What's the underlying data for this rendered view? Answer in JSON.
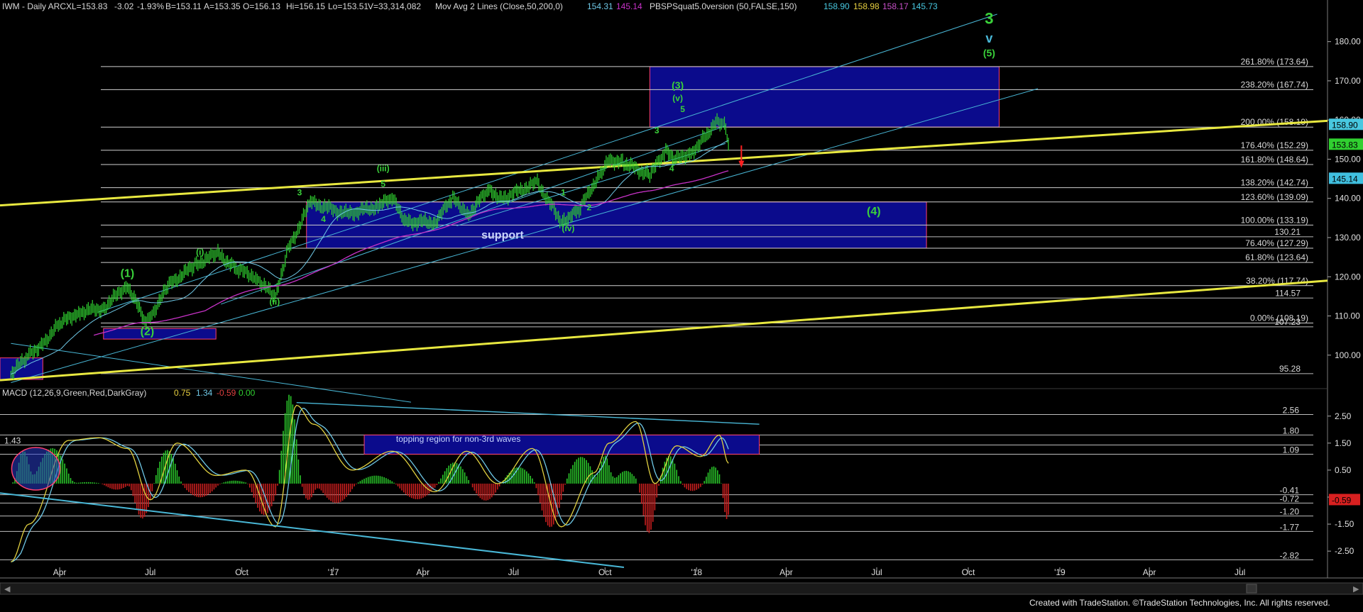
{
  "header": {
    "symbol": "IWM - Daily ARCX",
    "last": "L=153.83",
    "change": "-3.02",
    "pct": "-1.93%",
    "bid": "B=153.11",
    "ask": "A=153.35",
    "open": "O=156.13",
    "high": "Hi=156.15",
    "low": "Lo=153.51",
    "volume": "V=33,314,082",
    "study1": "Mov Avg 2 Lines (Close,50,200,0)",
    "ma50": "154.31",
    "ma200": "145.14",
    "study2": "PBSPSquat5.0version (50,FALSE,150)",
    "sq1": "158.90",
    "sq2": "158.98",
    "sq3": "158.17",
    "sq4": "145.73"
  },
  "macd_header": {
    "title": "MACD (12,26,9,Green,Red,DarkGray)",
    "v1": "0.75",
    "v2": "1.34",
    "v3": "-0.59",
    "v4": "0.00"
  },
  "footer": "Created with TradeStation. ©TradeStation Technologies, Inc. All rights reserved.",
  "colors": {
    "background": "#000000",
    "price": "#30d030",
    "ma50": "#6fc8e6",
    "ma200": "#c832c8",
    "trendline": "#e8e840",
    "channel": "#49b7d6",
    "box_fill": "#0b0b8c",
    "box_edge": "#ff3f6f",
    "fib_line": "#cfcfcf",
    "wave_label": "#3ad13a",
    "macd_hist_pos": "#2ac62a",
    "macd_hist_neg": "#c81e1e",
    "macd_line": "#e0d040",
    "signal_line": "#6fc8e6"
  },
  "chart_data": [
    {
      "type": "line",
      "title": "",
      "series": [
        {
          "name": "IWM",
          "x": [
            "2016-02-12",
            "2016-03-01",
            "2016-03-15",
            "2016-04-01",
            "2016-04-20",
            "2016-05-15",
            "2016-06-08",
            "2016-06-27",
            "2016-07-20",
            "2016-08-15",
            "2016-09-07",
            "2016-09-25",
            "2016-10-15",
            "2016-11-04",
            "2016-11-15",
            "2016-12-09",
            "2017-01-15",
            "2017-02-15",
            "2017-03-01",
            "2017-03-15",
            "2017-04-13",
            "2017-05-01",
            "2017-05-17",
            "2017-06-05",
            "2017-06-20",
            "2017-07-25",
            "2017-08-18",
            "2017-09-05",
            "2017-09-25",
            "2017-10-05",
            "2017-10-20",
            "2017-11-15",
            "2017-12-01",
            "2017-12-12",
            "2017-12-28",
            "2018-01-10",
            "2018-01-23",
            "2018-01-29",
            "2018-02-02"
          ],
          "y": [
            95.3,
            100,
            103,
            108,
            111,
            112,
            118,
            108,
            118,
            123,
            126,
            122,
            120,
            114.6,
            126,
            139,
            136,
            138,
            140,
            134,
            134,
            140,
            136,
            142,
            140,
            144,
            134,
            137,
            146,
            150,
            149,
            146,
            152,
            150,
            152,
            156,
            160,
            158.5,
            153.8
          ]
        }
      ],
      "ma_lines": {
        "ma50": "154.31",
        "ma200": "145.14"
      },
      "fib_levels": [
        {
          "label": "261.80% (173.64)",
          "y": 173.64
        },
        {
          "label": "238.20% (167.74)",
          "y": 167.74
        },
        {
          "label": "200.00% (158.19)",
          "y": 158.19
        },
        {
          "label": "176.40% (152.29)",
          "y": 152.29
        },
        {
          "label": "161.80% (148.64)",
          "y": 148.64
        },
        {
          "label": "138.20% (142.74)",
          "y": 142.74
        },
        {
          "label": "123.60% (139.09)",
          "y": 139.09
        },
        {
          "label": "100.00% (133.19)",
          "y": 133.19
        },
        {
          "label": "76.40% (127.29)",
          "y": 127.29
        },
        {
          "label": "61.80% (123.64)",
          "y": 123.64
        },
        {
          "label": "38.20% (117.74)",
          "y": 117.74
        },
        {
          "label": "0.00% (108.19)",
          "y": 108.19
        }
      ],
      "price_labels": [
        {
          "label": "130.21",
          "y": 130.21
        },
        {
          "label": "114.57",
          "y": 114.57
        },
        {
          "label": "107.23",
          "y": 107.23
        },
        {
          "label": "95.28",
          "y": 95.28
        }
      ],
      "price_tags": [
        {
          "label": "158.90",
          "y": 158.9,
          "color": "#48c8e0"
        },
        {
          "label": "153.83",
          "y": 153.83,
          "color": "#30d030"
        },
        {
          "label": "145.14",
          "y": 145.14,
          "color": "#40c0e0"
        }
      ],
      "yticks": [
        100,
        110,
        120,
        130,
        140,
        150,
        160,
        170,
        180
      ],
      "ylim": [
        92,
        187
      ],
      "xticks": [
        {
          "label": "Apr",
          "x": "2016-04-01"
        },
        {
          "label": "Jul",
          "x": "2016-07-01"
        },
        {
          "label": "Oct",
          "x": "2016-10-01"
        },
        {
          "label": "'17",
          "x": "2017-01-01"
        },
        {
          "label": "Apr",
          "x": "2017-04-01"
        },
        {
          "label": "Jul",
          "x": "2017-07-01"
        },
        {
          "label": "Oct",
          "x": "2017-10-01"
        },
        {
          "label": "'18",
          "x": "2018-01-01"
        },
        {
          "label": "Apr",
          "x": "2018-04-01"
        },
        {
          "label": "Jul",
          "x": "2018-07-01"
        },
        {
          "label": "Oct",
          "x": "2018-10-01"
        },
        {
          "label": "'19",
          "x": "2019-01-01"
        },
        {
          "label": "Apr",
          "x": "2019-04-01"
        },
        {
          "label": "Jul",
          "x": "2019-07-01"
        }
      ],
      "xlim": [
        "2016-02-01",
        "2019-09-27"
      ],
      "boxes": [
        {
          "x0": "2017-11-15",
          "x1": "2018-11-01",
          "y0": 158.2,
          "y1": 173.6,
          "label": ""
        },
        {
          "x0": "2016-12-05",
          "x1": "2018-08-20",
          "y0": 127.3,
          "y1": 139.1,
          "label": "support"
        },
        {
          "x0": "2016-05-15",
          "x1": "2016-09-05",
          "y0": 104.1,
          "y1": 106.8,
          "label": ""
        },
        {
          "x0": "2016-02-01",
          "x1": "2016-03-15",
          "y0": 93.8,
          "y1": 99.3,
          "label": ""
        }
      ],
      "wave_labels": [
        {
          "text": "3",
          "x": "2018-10-22",
          "y": 184.6,
          "size": 22
        },
        {
          "text": "v",
          "x": "2018-10-22",
          "y": 179.8,
          "size": 18,
          "color": "#49b7d6"
        },
        {
          "text": "(5)",
          "x": "2018-10-22",
          "y": 176.2,
          "size": 14
        },
        {
          "text": "(3)",
          "x": "2017-12-13",
          "y": 168.0,
          "size": 14
        },
        {
          "text": "(v)",
          "x": "2017-12-13",
          "y": 164.8,
          "size": 12
        },
        {
          "text": "5",
          "x": "2017-12-18",
          "y": 162.0,
          "size": 12
        },
        {
          "text": "3",
          "x": "2017-11-22",
          "y": 156.6,
          "size": 12
        },
        {
          "text": "4",
          "x": "2017-12-07",
          "y": 146.9,
          "size": 12
        },
        {
          "text": "(iii)",
          "x": "2017-02-20",
          "y": 146.9,
          "size": 12
        },
        {
          "text": "5",
          "x": "2017-02-20",
          "y": 142.9,
          "size": 12
        },
        {
          "text": "3",
          "x": "2016-11-28",
          "y": 140.8,
          "size": 12
        },
        {
          "text": "4",
          "x": "2016-12-22",
          "y": 134.0,
          "size": 12
        },
        {
          "text": "1",
          "x": "2017-08-20",
          "y": 140.8,
          "size": 12
        },
        {
          "text": "2",
          "x": "2017-09-15",
          "y": 137.0,
          "size": 12
        },
        {
          "text": "(iv)",
          "x": "2017-08-25",
          "y": 131.6,
          "size": 12
        },
        {
          "text": "(4)",
          "x": "2018-06-28",
          "y": 135.8,
          "size": 16
        },
        {
          "text": "(i)",
          "x": "2016-08-20",
          "y": 125.6,
          "size": 12
        },
        {
          "text": "(1)",
          "x": "2016-06-08",
          "y": 120.0,
          "size": 16
        },
        {
          "text": "(ii)",
          "x": "2016-11-03",
          "y": 112.9,
          "size": 12
        },
        {
          "text": "(2)",
          "x": "2016-06-28",
          "y": 105.1,
          "size": 16
        }
      ],
      "annotations": [
        {
          "text": "support",
          "x": "2017-06-20",
          "y": 129.7
        }
      ]
    },
    {
      "type": "line",
      "title": "MACD (12,26,9,Green,Red,DarkGray)",
      "series": [
        {
          "name": "MACD",
          "x": [
            "2016-02-12",
            "2016-03-01",
            "2016-04-10",
            "2016-05-10",
            "2016-06-08",
            "2016-07-01",
            "2016-07-28",
            "2016-09-05",
            "2016-10-05",
            "2016-11-04",
            "2016-11-25",
            "2016-12-12",
            "2017-01-20",
            "2017-03-01",
            "2017-04-13",
            "2017-05-15",
            "2017-06-15",
            "2017-07-20",
            "2017-08-18",
            "2017-09-20",
            "2017-10-05",
            "2017-11-01",
            "2017-11-20",
            "2017-12-12",
            "2018-01-05",
            "2018-01-24",
            "2018-02-02"
          ],
          "y": [
            -2.9,
            -1.5,
            1.6,
            1.7,
            1.3,
            -0.6,
            1.5,
            0.3,
            0.5,
            -1.6,
            2.9,
            2.2,
            0.5,
            1.2,
            -0.3,
            1.2,
            0.0,
            1.3,
            -1.6,
            0.4,
            1.5,
            2.3,
            0.0,
            1.4,
            1.0,
            1.8,
            0.75
          ]
        }
      ],
      "histogram_sign_note": "",
      "yticks": [
        -2.5,
        -1.5,
        -0.5,
        0.5,
        1.5,
        2.5
      ],
      "ylim": [
        -3.1,
        3.15
      ],
      "levels": [
        {
          "label": "2.56",
          "y": 2.56
        },
        {
          "label": "1.80",
          "y": 1.8
        },
        {
          "label": "1.43",
          "y": 1.43
        },
        {
          "label": "1.09",
          "y": 1.09
        },
        {
          "label": "-0.41",
          "y": -0.41
        },
        {
          "label": "-0.72",
          "y": -0.72
        },
        {
          "label": "-1.20",
          "y": -1.2
        },
        {
          "label": "-1.77",
          "y": -1.77
        },
        {
          "label": "-2.82",
          "y": -2.82
        }
      ],
      "price_tags": [
        {
          "label": "-0.59",
          "y": -0.59,
          "color": "#d82020"
        }
      ],
      "box": {
        "x0": "2017-02-01",
        "x1": "2018-03-05",
        "y0": 1.09,
        "y1": 1.8,
        "label": "topping region for non-3rd waves"
      }
    }
  ]
}
